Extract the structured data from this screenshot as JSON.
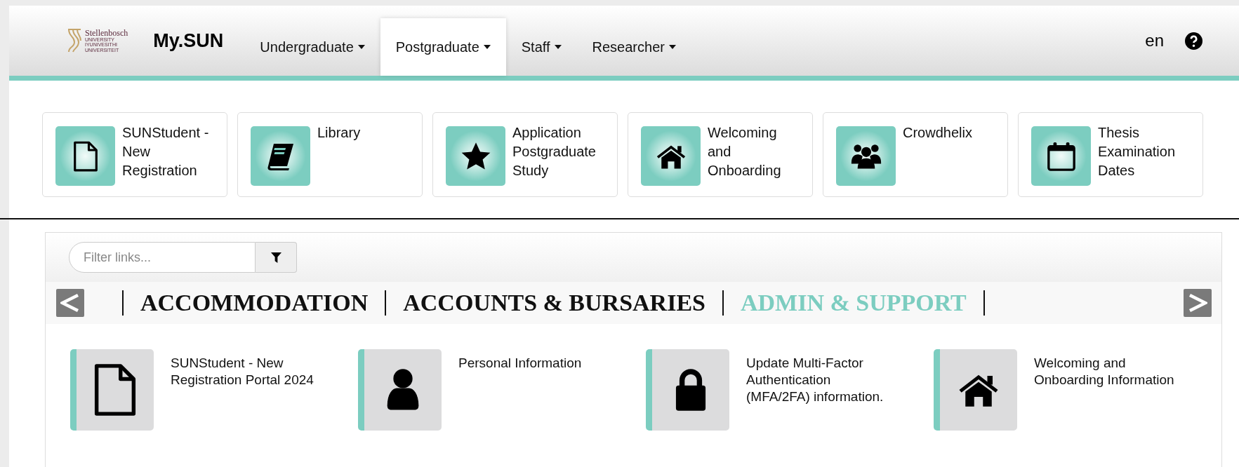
{
  "header": {
    "logo": {
      "name": "Stellenbosch",
      "lines": [
        "UNIVERSITY",
        "IYUNIVESITHI",
        "UNIVERSITEIT"
      ]
    },
    "brand": "My.SUN",
    "nav": [
      {
        "label": "Undergraduate",
        "selected": false
      },
      {
        "label": "Postgraduate",
        "selected": true
      },
      {
        "label": "Staff",
        "selected": false
      },
      {
        "label": "Researcher",
        "selected": false
      }
    ],
    "language": "en"
  },
  "quick_links": [
    {
      "label": "SUNStudent - New Registration"
    },
    {
      "label": "Library"
    },
    {
      "label": "Application Postgraduate Study"
    },
    {
      "label": "Welcoming and Onboarding"
    },
    {
      "label": "Crowdhelix"
    },
    {
      "label": "Thesis Examination Dates"
    }
  ],
  "filter": {
    "placeholder": "Filter links..."
  },
  "categories": [
    {
      "label": "ACCOMMODATION",
      "selected": false
    },
    {
      "label": "ACCOUNTS & BURSARIES",
      "selected": false
    },
    {
      "label": "ADMIN & SUPPORT",
      "selected": true
    }
  ],
  "links": [
    {
      "label": "SUNStudent - New Registration Portal 2024"
    },
    {
      "label": "Personal Information"
    },
    {
      "label": "Update Multi-Factor Authentication (MFA/2FA) information."
    },
    {
      "label": "Welcoming and Onboarding Information"
    }
  ]
}
